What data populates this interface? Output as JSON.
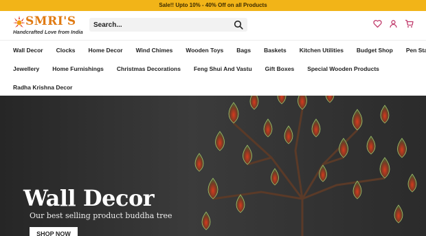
{
  "announcement": "Sale!! Upto 10% - 40% Off on all Products",
  "brand": {
    "name": "SMRI'S",
    "tagline": "Handcrafted Love from India"
  },
  "search": {
    "placeholder": "Search..."
  },
  "header_icons": [
    "heart-icon",
    "user-icon",
    "cart-icon"
  ],
  "nav": {
    "row1": [
      "Wall Decor",
      "Clocks",
      "Home Decor",
      "Wind Chimes",
      "Wooden Toys",
      "Bags",
      "Baskets",
      "Kitchen Utilities",
      "Budget Shop",
      "Pen Stand"
    ],
    "row2": [
      "Jewellery",
      "Home Furnishings",
      "Christmas Decorations",
      "Feng Shui And Vastu",
      "Gift Boxes",
      "Special Wooden Products"
    ],
    "row3": [
      "Radha Krishna Decor"
    ]
  },
  "hero": {
    "title": "Wall Decor",
    "subtitle": "Our best selling product buddha tree",
    "cta": "SHOP NOW"
  },
  "colors": {
    "announcement_bg": "#f2b418",
    "accent": "#e07a12",
    "icon": "#c03a6b",
    "hero_bg": "#2f2f2f"
  }
}
